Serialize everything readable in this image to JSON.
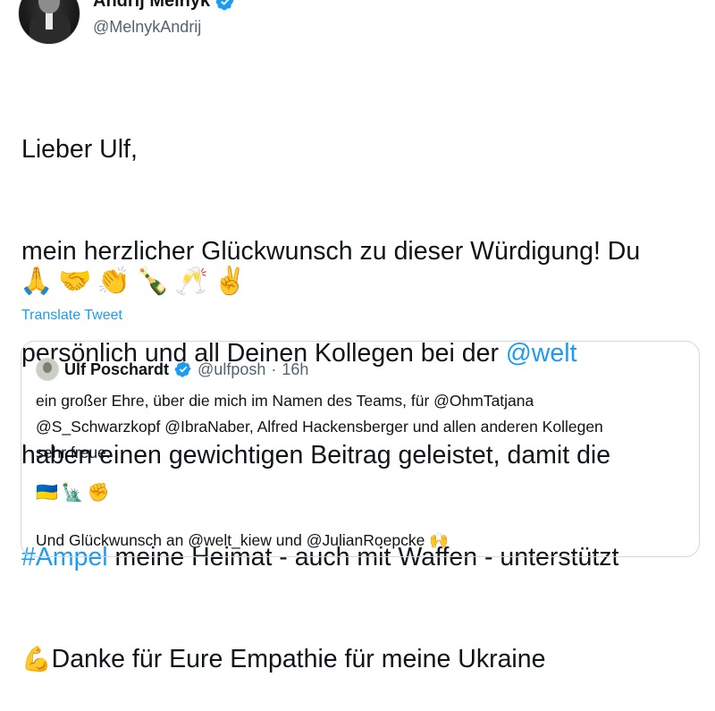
{
  "author": {
    "name": "Andrij Melnyk",
    "handle": "@MelnykAndrij"
  },
  "tweet": {
    "lines": [
      "Lieber Ulf,",
      "mein herzlicher Glückwunsch zu dieser Würdigung! Du",
      "persönlich und all Deinen Kollegen bei der ",
      "@welt",
      "haben einen gewichtigen Beitrag geleistet, damit die",
      "#Ampel",
      " meine Heimat - auch mit Waffen - unterstützt",
      "💪",
      "Danke für Eure Empathie für meine Ukraine"
    ],
    "emoji_row": [
      "🙏",
      "🤝",
      "👏",
      "🍾",
      "🥂",
      "✌️"
    ],
    "translate_label": "Translate Tweet"
  },
  "quote": {
    "name": "Ulf Poschardt",
    "handle": "@ulfposh",
    "separator": "·",
    "time": "16h",
    "text_lines": [
      "ein großer Ehre, über die mich im Namen des Teams, für @OhmTatjana",
      "@S_Schwarzkopf @IbraNaber, Alfred Hackensberger und allen anderen Kollegen",
      "sehr freue."
    ],
    "emojis": [
      "🇺🇦",
      "🗽",
      "✊"
    ],
    "cut_line": "Und Glückwunsch an @welt_kiew und @JulianRoepcke 🙌"
  },
  "colors": {
    "link": "#1d9bf0",
    "verified": "#1d9bf0",
    "muted": "#536471",
    "border": "#cfd9de"
  },
  "icons": [
    "verified-badge-icon",
    "more-options-icon"
  ]
}
